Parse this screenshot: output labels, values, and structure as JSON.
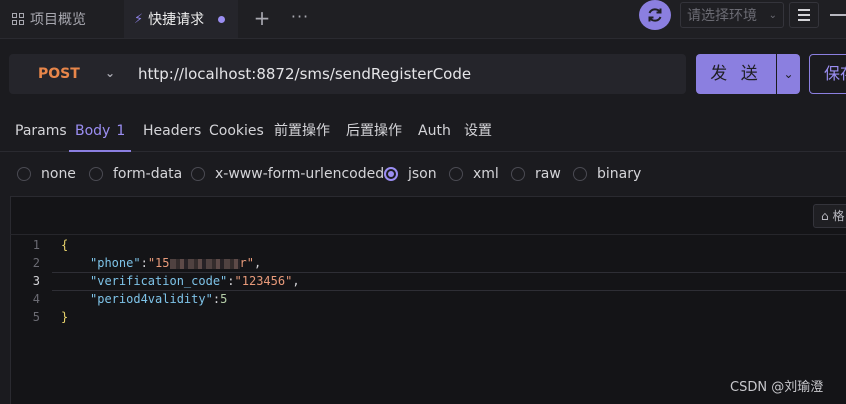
{
  "tabs": {
    "project": "项目概览",
    "quick_request": "快捷请求"
  },
  "toolbar": {
    "env_placeholder": "请选择环境"
  },
  "request": {
    "method": "POST",
    "url": "http://localhost:8872/sms/sendRegisterCode",
    "send_label": "发 送",
    "save_label": "保存"
  },
  "subtabs": [
    "Params",
    "Body",
    "Headers",
    "Cookies",
    "前置操作",
    "后置操作",
    "Auth",
    "设置"
  ],
  "body_count": "1",
  "body_types": [
    "none",
    "form-data",
    "x-www-form-urlencoded",
    "json",
    "xml",
    "raw",
    "binary"
  ],
  "selected_body_type": "json",
  "editor": {
    "format_label": "格",
    "line_numbers": [
      "1",
      "2",
      "3",
      "4",
      "5"
    ],
    "lines": {
      "l1_open": "{",
      "phone_key": "\"phone\"",
      "phone_value_prefix": "\"15",
      "phone_value_suffix": "r\"",
      "code_key": "\"verification_code\"",
      "code_value": "\"123456\"",
      "period_key": "\"period4validity\"",
      "period_value": "5",
      "l5_close": "}"
    }
  },
  "watermark": "CSDN @刘瑜澄",
  "colors": {
    "accent": "#8b7fe0",
    "method_post": "#e8864a"
  }
}
